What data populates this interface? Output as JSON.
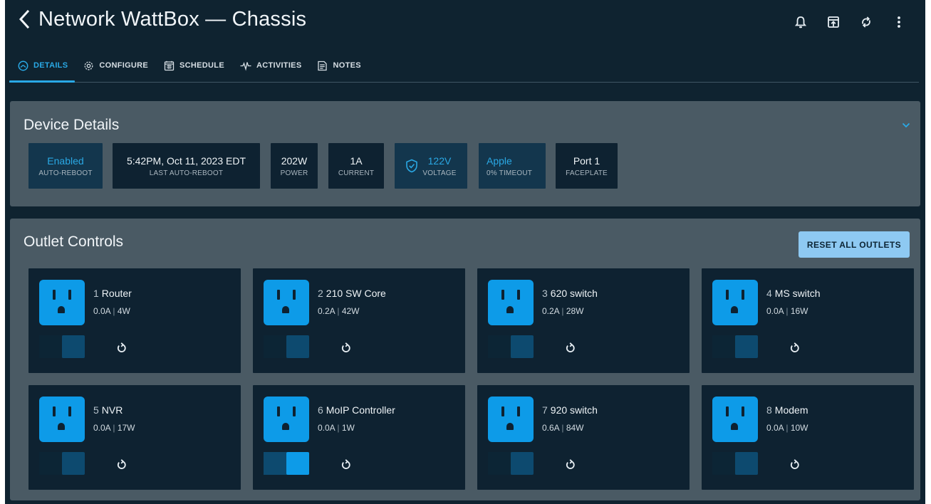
{
  "header": {
    "title": "Network WattBox — Chassis",
    "back_icon": "chevron-left-icon",
    "actions": [
      "bell-icon",
      "open-in-app-icon",
      "refresh-icon",
      "more-vertical-icon"
    ]
  },
  "tabs": [
    {
      "label": "DETAILS",
      "icon": "gauge-icon",
      "active": true
    },
    {
      "label": "CONFIGURE",
      "icon": "gear-icon",
      "active": false
    },
    {
      "label": "SCHEDULE",
      "icon": "calendar-icon",
      "active": false
    },
    {
      "label": "ACTIVITIES",
      "icon": "pulse-icon",
      "active": false
    },
    {
      "label": "NOTES",
      "icon": "notes-icon",
      "active": false
    }
  ],
  "device_details": {
    "title": "Device Details",
    "stats": [
      {
        "value": "Enabled",
        "label": "AUTO-REBOOT",
        "highlight": true
      },
      {
        "value": "5:42PM, Oct 11, 2023 EDT",
        "label": "LAST AUTO-REBOOT",
        "highlight": false
      },
      {
        "value": "202W",
        "label": "POWER",
        "highlight": false
      },
      {
        "value": "1A",
        "label": "CURRENT",
        "highlight": false
      },
      {
        "value": "122V",
        "label": "VOLTAGE",
        "highlight": true,
        "icon": "shield-check-icon"
      },
      {
        "value": "Apple",
        "label": "0% TIMEOUT",
        "highlight": true
      },
      {
        "value": "Port 1",
        "label": "FACEPLATE",
        "highlight": false
      }
    ]
  },
  "outlet_controls": {
    "title": "Outlet Controls",
    "reset_label": "RESET ALL OUTLETS",
    "outlets": [
      {
        "num": "1",
        "name": "Router",
        "amps": "0.0A",
        "watts": "4W",
        "on": false
      },
      {
        "num": "2",
        "name": "210 SW Core",
        "amps": "0.2A",
        "watts": "42W",
        "on": false
      },
      {
        "num": "3",
        "name": "620 switch",
        "amps": "0.2A",
        "watts": "28W",
        "on": false
      },
      {
        "num": "4",
        "name": "MS switch",
        "amps": "0.0A",
        "watts": "16W",
        "on": false
      },
      {
        "num": "5",
        "name": "NVR",
        "amps": "0.0A",
        "watts": "17W",
        "on": false
      },
      {
        "num": "6",
        "name": "MoIP Controller",
        "amps": "0.0A",
        "watts": "1W",
        "on": true
      },
      {
        "num": "7",
        "name": "920 switch",
        "amps": "0.6A",
        "watts": "84W",
        "on": false
      },
      {
        "num": "8",
        "name": "Modem",
        "amps": "0.0A",
        "watts": "10W",
        "on": false
      }
    ]
  },
  "colors": {
    "background": "#0f2330",
    "panel": "#4a5a64",
    "accent": "#29a9e6",
    "outlet_icon": "#0d9be8",
    "reset_button": "#8ec9f2"
  }
}
